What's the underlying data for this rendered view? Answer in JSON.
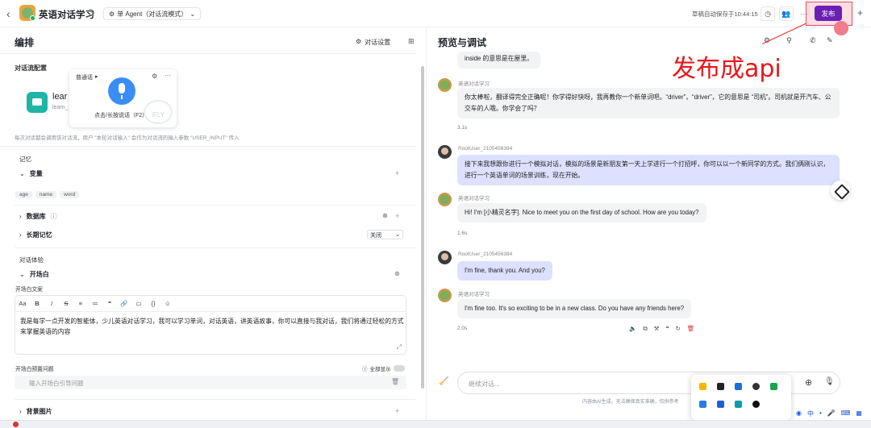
{
  "header": {
    "back": "‹",
    "title": "英语对话学习",
    "mode": "单 Agent（对话流模式）",
    "mode_arrow": "⌄",
    "autosave": "草稿自动保存于10:44:15",
    "more": "···",
    "publish": "发布",
    "plus": "+"
  },
  "left": {
    "title": "编排",
    "settings": "对话设置",
    "flow_config": "对话流配置",
    "flow_name": "lear",
    "flow_sub": "learn_",
    "flow_note": "每次对话都会调用该对话流，用户 \"本轮对话输入\" 会作为对话流的输入参数 \"USER_INPUT\" 传入",
    "voice_popup": {
      "lang": "普通话",
      "lang_arrow": "▸",
      "hint": "点击/长按说话（F2）",
      "brand": "iFLY"
    },
    "memory": "记忆",
    "variables": "变量",
    "var_chips": [
      "age",
      "name",
      "word"
    ],
    "database": "数据库",
    "ltm": "长期记忆",
    "ltm_state": "关闭",
    "experience": "对话体验",
    "opening": "开场白",
    "opening_text_label": "开场白文案",
    "toolbar": [
      "Aa",
      "B",
      "I",
      "S",
      "≡",
      "≔",
      "❝",
      "🔗",
      "▭",
      "{}",
      "☺"
    ],
    "opening_text": "我是每学一点开发的智能体，少儿英语对话学习，我可以学习单词，对话英语，讲英语故事，你可以直接与我对话，我们将通过轻松的方式来掌握英语的内容",
    "guide_label": "开场白预置问题",
    "show_all": "全部显示",
    "guide_placeholder": "输入开场白引导问题",
    "bg_image": "背景图片"
  },
  "right": {
    "title": "预览与调试",
    "annotation": "发布成api",
    "messages": [
      {
        "role": "bot",
        "text": "inside 的意思是在屋里。"
      },
      {
        "role": "bot",
        "name": "英语对话学习",
        "text": "你太棒啦，翻译得完全正确呢！你学得好快呀，我再教你一个新单词吧。“driver”，“driver”，它的意思是 “司机”。司机就是开汽车、公交车的人哦。你学会了吗？",
        "time": "3.1s"
      },
      {
        "role": "user",
        "name": "RootUser_2105456384",
        "text": "接下来我想跟你进行一个模拟对话，模拟的场景是新朋友第一天上学进行一个打招呼，你可以以一个新同学的方式。我们俩刚认识，进行一个英语单词的场景训练，现在开始。"
      },
      {
        "role": "bot",
        "name": "英语对话学习",
        "text": "Hi! I'm [小精灵名字]. Nice to meet you on the first day of school. How are you today?",
        "time": "1.6s"
      },
      {
        "role": "user",
        "name": "RootUser_2105456384",
        "text": "I'm fine, thank you. And you?"
      },
      {
        "role": "bot",
        "name": "英语对话学习",
        "text": "I'm fine too. It's so exciting to be in a new class. Do you have any friends here?",
        "time": "2.0s"
      }
    ],
    "chat_placeholder": "继续对话...",
    "disclaimer": "内容由AI生成，无法确保真实准确，仅供参考",
    "taskbar_ime": "中"
  }
}
